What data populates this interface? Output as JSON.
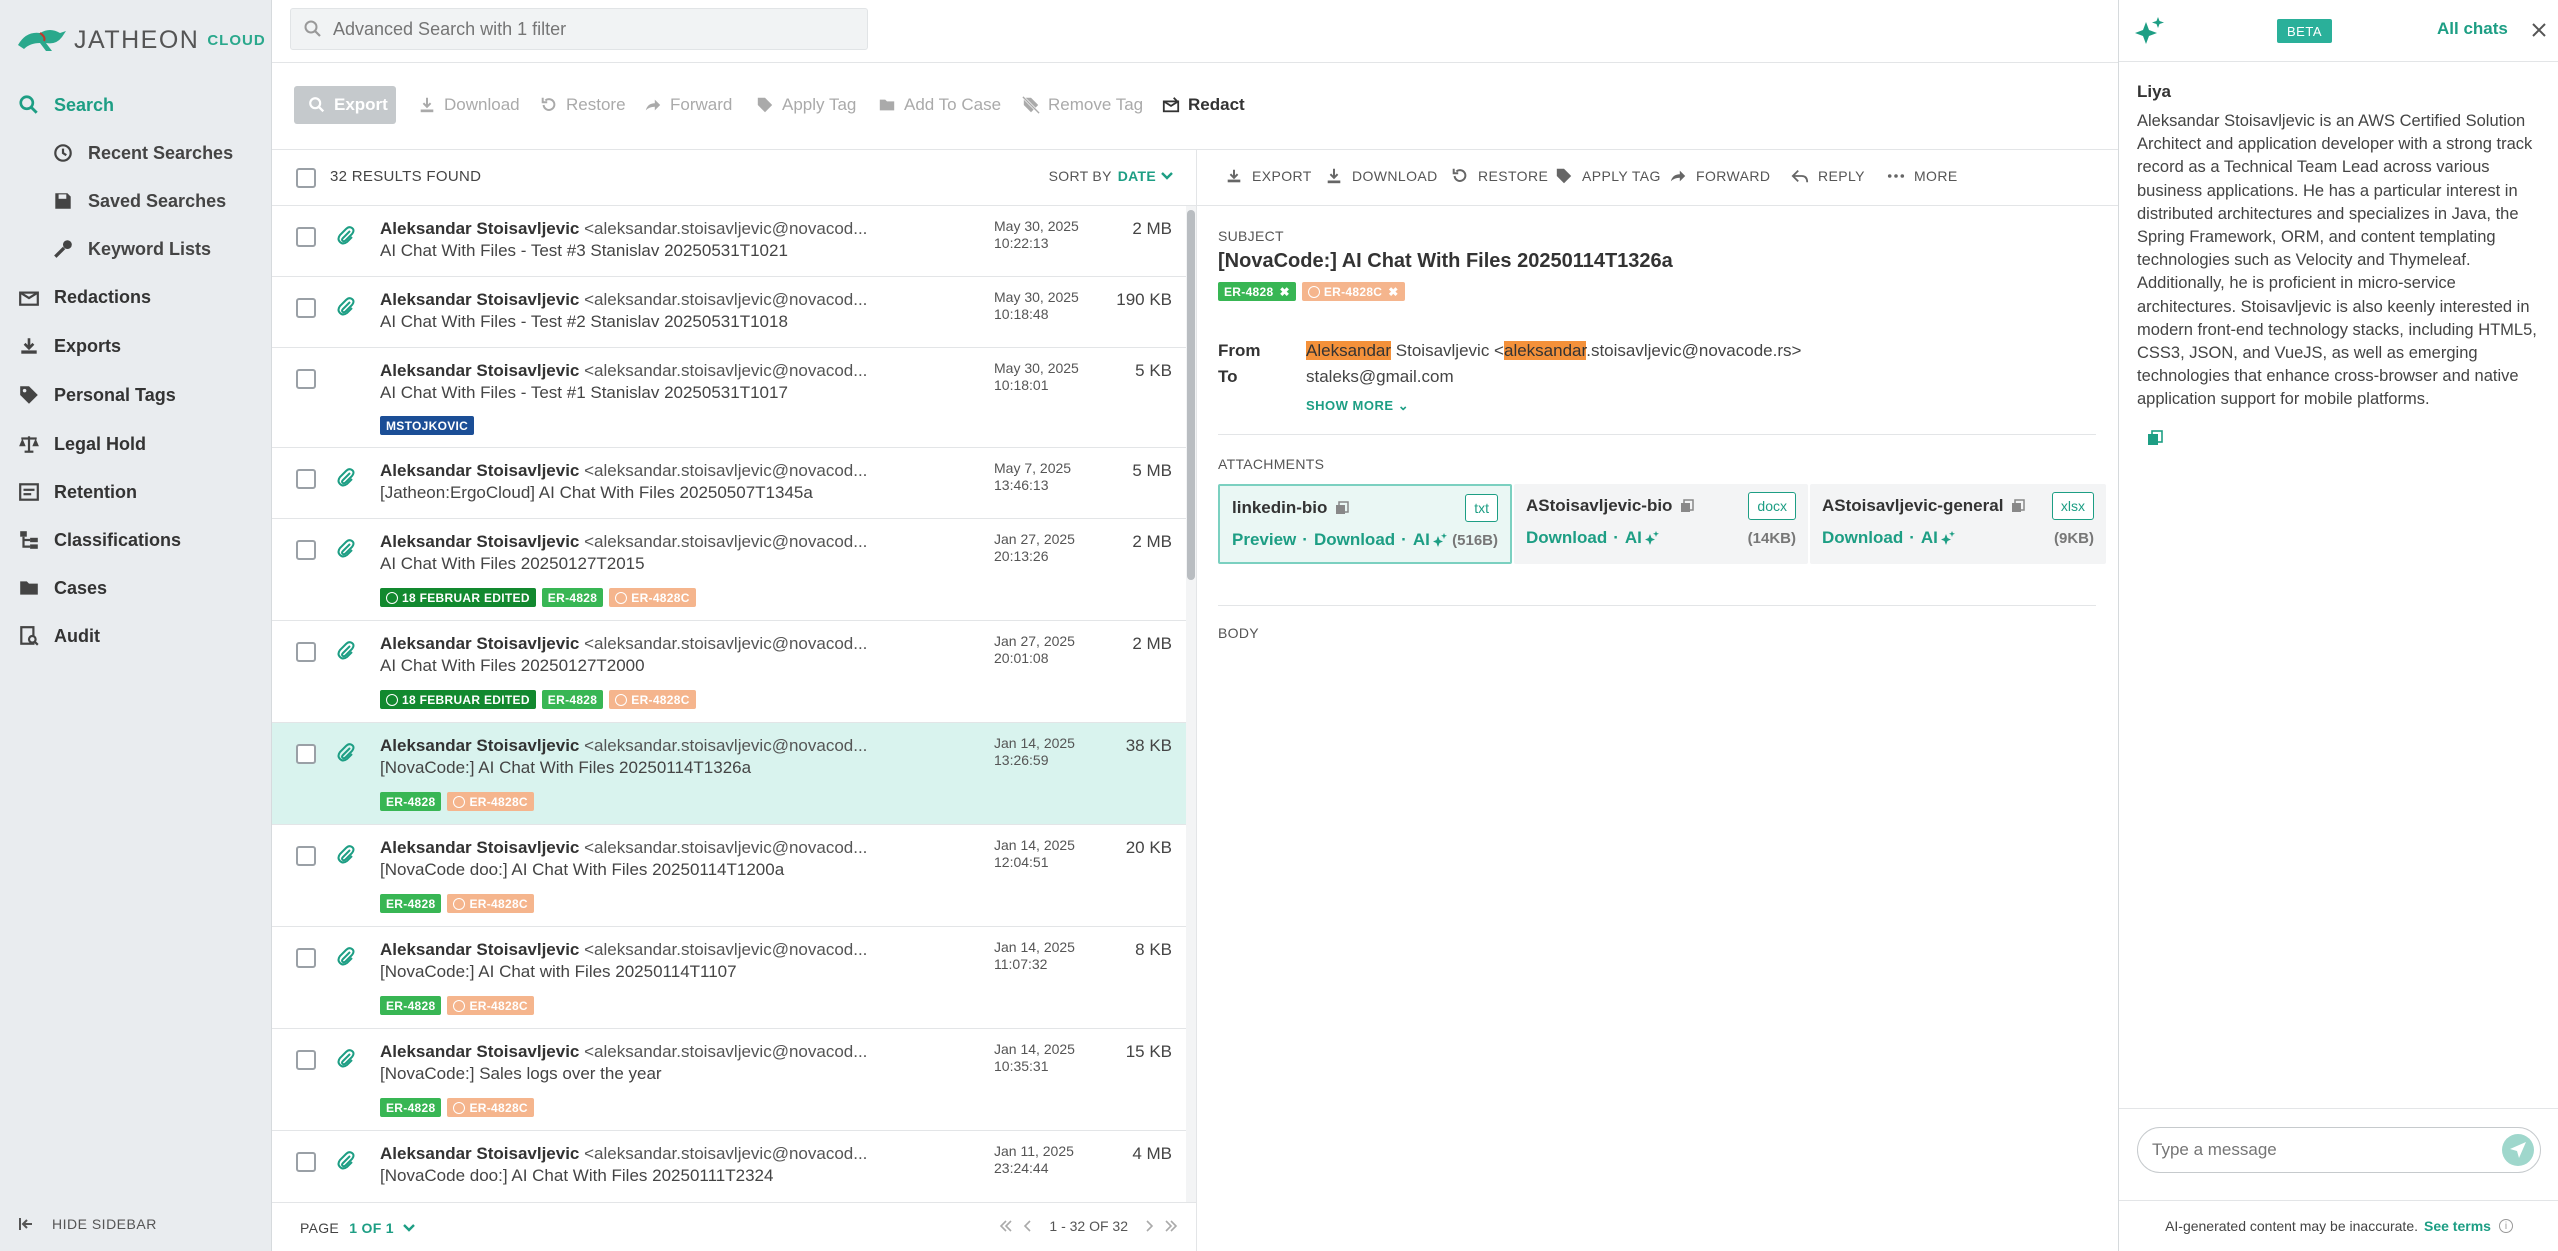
{
  "brand": {
    "name": "JATHEON",
    "suffix": "CLOUD"
  },
  "search": {
    "placeholder": "Advanced Search with 1 filter"
  },
  "sidebar": {
    "items": [
      {
        "label": "Search",
        "icon": "search-icon"
      },
      {
        "label": "Recent Searches",
        "icon": "history-icon"
      },
      {
        "label": "Saved Searches",
        "icon": "save-icon"
      },
      {
        "label": "Keyword Lists",
        "icon": "key-icon"
      },
      {
        "label": "Redactions",
        "icon": "redaction-icon"
      },
      {
        "label": "Exports",
        "icon": "export-icon"
      },
      {
        "label": "Personal Tags",
        "icon": "tag-icon"
      },
      {
        "label": "Legal Hold",
        "icon": "legal-hold-icon"
      },
      {
        "label": "Retention",
        "icon": "retention-icon"
      },
      {
        "label": "Classifications",
        "icon": "classification-icon"
      },
      {
        "label": "Cases",
        "icon": "folder-icon"
      },
      {
        "label": "Audit",
        "icon": "audit-icon"
      }
    ],
    "hide_label": "HIDE SIDEBAR"
  },
  "toolbar": {
    "export": "Export",
    "download": "Download",
    "restore": "Restore",
    "forward": "Forward",
    "apply_tag": "Apply Tag",
    "add_to_case": "Add To Case",
    "remove_tag": "Remove Tag",
    "redact": "Redact"
  },
  "list": {
    "results": "32 RESULTS FOUND",
    "sort_label": "SORT BY",
    "sort_value": "DATE",
    "rows": [
      {
        "sender": "Aleksandar Stoisavljevic",
        "email": "<aleksandar.stoisavljevic@novacod...",
        "subject": "AI Chat With Files - Test #3 Stanislav 20250531T1021",
        "date": "May 30, 2025",
        "time": "10:22:13",
        "size": "2 MB"
      },
      {
        "sender": "Aleksandar Stoisavljevic",
        "email": "<aleksandar.stoisavljevic@novacod...",
        "subject": "AI Chat With Files - Test #2 Stanislav 20250531T1018",
        "date": "May 30, 2025",
        "time": "10:18:48",
        "size": "190 KB"
      },
      {
        "sender": "Aleksandar Stoisavljevic",
        "email": "<aleksandar.stoisavljevic@novacod...",
        "subject": "AI Chat With Files - Test #1 Stanislav 20250531T1017",
        "date": "May 30, 2025",
        "time": "10:18:01",
        "size": "5 KB",
        "tags": [
          "MSTOJKOVIC"
        ]
      },
      {
        "sender": "Aleksandar Stoisavljevic",
        "email": "<aleksandar.stoisavljevic@novacod...",
        "subject": "[Jatheon:ErgoCloud] AI Chat With Files 20250507T1345a",
        "date": "May 7, 2025",
        "time": "13:46:13",
        "size": "5 MB"
      },
      {
        "sender": "Aleksandar Stoisavljevic",
        "email": "<aleksandar.stoisavljevic@novacod...",
        "subject": "AI Chat With Files 20250127T2015",
        "date": "Jan 27, 2025",
        "time": "20:13:26",
        "size": "2 MB",
        "tags": [
          "18 FEBRUAR EDITED",
          "ER-4828",
          "ER-4828C"
        ]
      },
      {
        "sender": "Aleksandar Stoisavljevic",
        "email": "<aleksandar.stoisavljevic@novacod...",
        "subject": "AI Chat With Files 20250127T2000",
        "date": "Jan 27, 2025",
        "time": "20:01:08",
        "size": "2 MB",
        "tags": [
          "18 FEBRUAR EDITED",
          "ER-4828",
          "ER-4828C"
        ]
      },
      {
        "sender": "Aleksandar Stoisavljevic",
        "email": "<aleksandar.stoisavljevic@novacod...",
        "subject": "[NovaCode:] AI Chat With Files 20250114T1326a",
        "date": "Jan 14, 2025",
        "time": "13:26:59",
        "size": "38 KB",
        "tags": [
          "ER-4828",
          "ER-4828C"
        ]
      },
      {
        "sender": "Aleksandar Stoisavljevic",
        "email": "<aleksandar.stoisavljevic@novacod...",
        "subject": "[NovaCode doo:] AI Chat With Files 20250114T1200a",
        "date": "Jan 14, 2025",
        "time": "12:04:51",
        "size": "20 KB",
        "tags": [
          "ER-4828",
          "ER-4828C"
        ]
      },
      {
        "sender": "Aleksandar Stoisavljevic",
        "email": "<aleksandar.stoisavljevic@novacod...",
        "subject": "[NovaCode:] AI Chat with Files 20250114T1107",
        "date": "Jan 14, 2025",
        "time": "11:07:32",
        "size": "8 KB",
        "tags": [
          "ER-4828",
          "ER-4828C"
        ]
      },
      {
        "sender": "Aleksandar Stoisavljevic",
        "email": "<aleksandar.stoisavljevic@novacod...",
        "subject": "[NovaCode:] Sales logs over the year",
        "date": "Jan 14, 2025",
        "time": "10:35:31",
        "size": "15 KB",
        "tags": [
          "ER-4828",
          "ER-4828C"
        ]
      },
      {
        "sender": "Aleksandar Stoisavljevic",
        "email": "<aleksandar.stoisavljevic@novacod...",
        "subject": "[NovaCode doo:] AI Chat With Files 20250111T2324",
        "date": "Jan 11, 2025",
        "time": "23:24:44",
        "size": "4 MB"
      }
    ],
    "page_label": "PAGE",
    "page_value": "1 OF 1",
    "range": "1 - 32 OF 32"
  },
  "detail": {
    "toolbar": {
      "export": "EXPORT",
      "download": "DOWNLOAD",
      "restore": "RESTORE",
      "apply_tag": "APPLY TAG",
      "forward": "FORWARD",
      "reply": "REPLY",
      "more": "MORE"
    },
    "subject_label": "SUBJECT",
    "subject": "[NovaCode:] AI Chat With Files 20250114T1326a",
    "tags": [
      "ER-4828",
      "ER-4828C"
    ],
    "from_label": "From",
    "from_hl1": "Aleksandar",
    "from_mid": " Stoisavljevic <",
    "from_hl2": "aleksandar",
    "from_rest": ".stoisavljevic@novacode.rs>",
    "to_label": "To",
    "to": "staleks@gmail.com",
    "show_more": "SHOW MORE",
    "attachments_label": "ATTACHMENTS",
    "attachments": [
      {
        "name": "linkedin-bio",
        "ext": "txt",
        "preview": "Preview",
        "download": "Download",
        "ai": "AI",
        "size": "(516B)"
      },
      {
        "name": "AStoisavljevic-bio",
        "ext": "docx",
        "download": "Download",
        "ai": "AI",
        "size": "(14KB)"
      },
      {
        "name": "AStoisavljevic-general",
        "ext": "xlsx",
        "download": "Download",
        "ai": "AI",
        "size": "(9KB)"
      }
    ],
    "body_label": "BODY"
  },
  "ai": {
    "beta": "BETA",
    "all_chats": "All chats",
    "sender": "Liya",
    "message": "Aleksandar Stoisavljevic is an AWS Certified Solution Architect and application developer with a strong track record as a Technical Team Lead across various business applications. He has a particular interest in distributed architectures and specializes in Java, the Spring Framework, ORM, and content templating technologies such as Velocity and Thymeleaf. Additionally, he is proficient in micro-service architectures. Stoisavljevic is also keenly interested in modern front-end technology stacks, including HTML5, CSS3, JSON, and VueJS, as well as emerging technologies that enhance cross-browser and native application support for mobile platforms.",
    "input_placeholder": "Type a message",
    "disclaimer": "AI-generated content may be inaccurate.",
    "see_terms": "See terms"
  },
  "colors": {
    "accent": "#1d9e84",
    "tag_green": "#38b654",
    "tag_dark_green": "#12892f",
    "tag_orange": "#f5b58d",
    "tag_navy": "#1b4e96",
    "selected_row": "#d9f3ee",
    "highlight": "#f4913a"
  }
}
